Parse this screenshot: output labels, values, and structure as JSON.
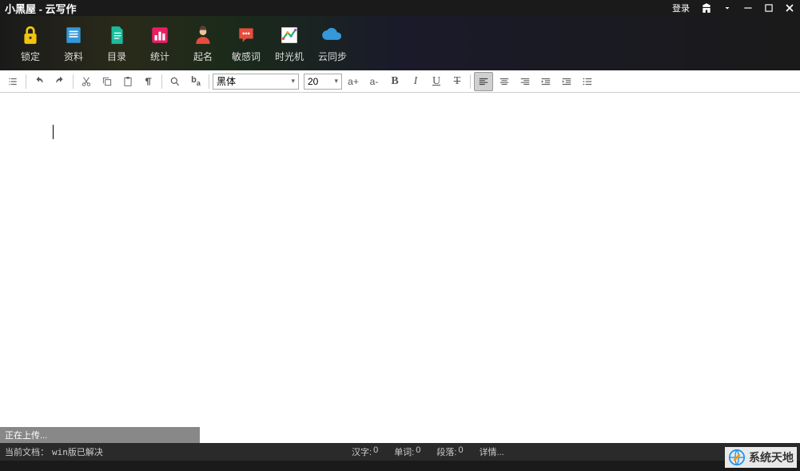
{
  "title": "小黑屋 - 云写作",
  "titlebar": {
    "login": "登录"
  },
  "toolbar": {
    "lock": "锁定",
    "data": "资料",
    "catalog": "目录",
    "stats": "统计",
    "naming": "起名",
    "sensitive": "敏感词",
    "timemachine": "时光机",
    "cloudsync": "云同步"
  },
  "format": {
    "font": "黑体",
    "size": "20",
    "fontIncrease": "a+",
    "fontDecrease": "a-",
    "bold": "B",
    "italic": "I",
    "underline": "U",
    "strike": "T"
  },
  "upload": {
    "status": "正在上传..."
  },
  "status": {
    "docLabel": "当前文档：",
    "docName": "win版已解决",
    "chars": "汉字:",
    "charsVal": "0",
    "words": "单词:",
    "wordsVal": "0",
    "paras": "段落:",
    "parasVal": "0",
    "detail": "详情..."
  },
  "watermark": "系统天地"
}
